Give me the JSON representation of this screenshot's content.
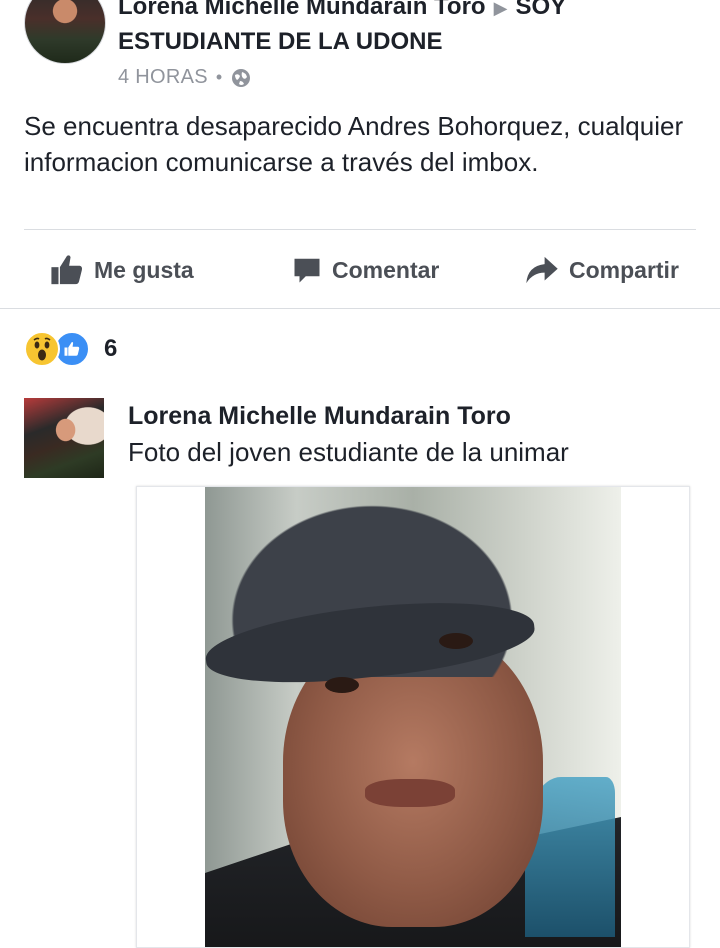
{
  "post": {
    "author": "Lorena Michelle Mundarain Toro",
    "arrow": "▶",
    "group": "SOY ESTUDIANTE DE LA UDONE",
    "time": "4 HORAS",
    "separator": "•",
    "text": "Se encuentra desaparecido Andres Bohorquez, cualquier informacion comunicarse a través del imbox."
  },
  "actions": {
    "like_label": "Me gusta",
    "comment_label": "Comentar",
    "share_label": "Compartir"
  },
  "reactions": {
    "count": "6",
    "icons": [
      "wow-icon",
      "like-icon"
    ]
  },
  "shared": {
    "author": "Lorena Michelle Mundarain Toro",
    "caption": "Foto del joven estudiante de la unimar"
  },
  "colors": {
    "text": "#1d2129",
    "meta": "#90949c",
    "action": "#4b4f56",
    "like_blue": "#3b8ff5",
    "wow_yellow": "#f7c531",
    "divider": "#dadde1"
  }
}
